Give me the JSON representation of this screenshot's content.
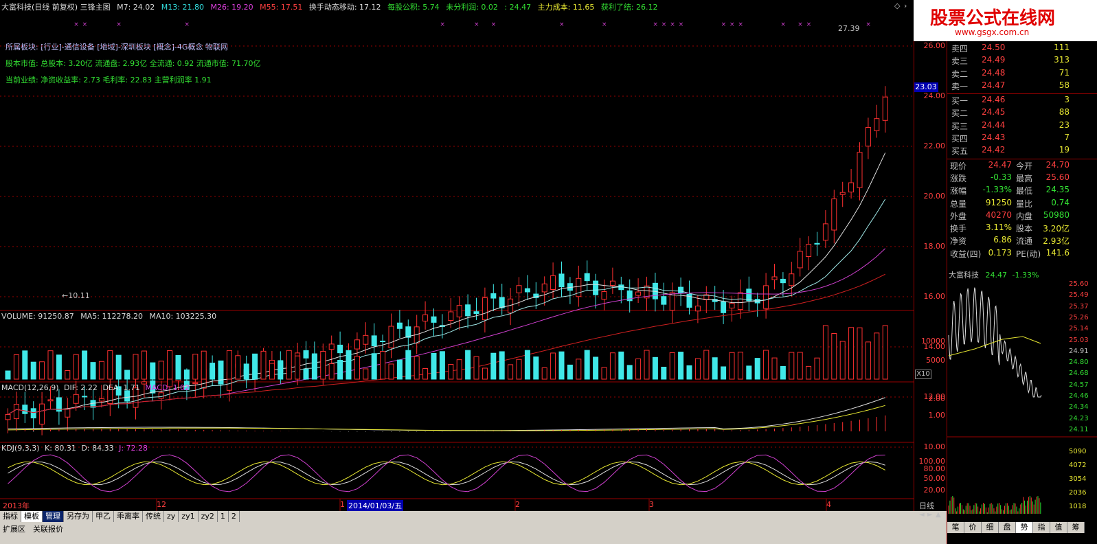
{
  "header": {
    "stock": "大富科技(日线 前复权) 三锋主图",
    "ma7": "M7: 24.02",
    "ma13": "M13: 21.80",
    "ma26": "M26: 19.20",
    "ma55": "M55: 17.51",
    "huanshou": "换手动态移动: 17.12",
    "gongji": "每股公积: 5.74",
    "weifen": "未分利润: 0.02",
    "price": ": 24.47",
    "chengben": "主力成本: 11.65",
    "huoli": "获利了结: 26.12"
  },
  "info_lines": {
    "sector": "所属板块: [行业]-通信设备 [地域]-深圳板块 [概念]-4G概念 物联网",
    "capital": "股本市值: 总股本: 3.20亿 流通盘: 2.93亿 全流通: 0.92 流通市值: 71.70亿",
    "performance": "当前业绩: 净资收益率: 2.73 毛利率: 22.83 主营利润率 1.91"
  },
  "price_axis": [
    "26.00",
    "24.00",
    "22.00",
    "20.00",
    "18.00",
    "16.00",
    "14.00",
    "12.00",
    "10.00"
  ],
  "current_price_tag": "23.03",
  "high_mark": "27.39",
  "low_mark": "←10.11",
  "volume": {
    "title": "VOLUME: 91250.87",
    "ma5": "MA5: 112278.20",
    "ma10": "MA10: 103225.30",
    "axis": [
      "10000",
      "5000"
    ],
    "unit": "X10"
  },
  "macd": {
    "title": "MACD(12,26,9)",
    "dif": "DIF: 2.22",
    "dea": "DEA: 1.71",
    "macd": "MACD: 1.02",
    "axis": [
      "2.00",
      "1.00"
    ]
  },
  "kdj": {
    "title": "KDJ(9,3,3)",
    "k": "K: 80.31",
    "d": "D: 84.33",
    "j": "J: 72.28",
    "axis": [
      "100.00",
      "80.00",
      "50.00",
      "20.00"
    ]
  },
  "date_axis": {
    "year": "2013年",
    "m12": "12",
    "m1": "1",
    "cursor_date": "2014/01/03/五",
    "m2": "2",
    "m3": "3",
    "m4": "4"
  },
  "tabs": [
    "指标",
    "模板",
    "管理",
    "另存为",
    "甲乙",
    "乖离率",
    "传统",
    "zy",
    "zy1",
    "zy2",
    "1",
    "2"
  ],
  "status": [
    "扩展区",
    "关联报价"
  ],
  "logo": {
    "title": "股票公式在线网",
    "url": "www.gsgx.com.cn"
  },
  "quote": {
    "asks": [
      {
        "name": "卖四",
        "price": "24.50",
        "vol": "111"
      },
      {
        "name": "卖三",
        "price": "24.49",
        "vol": "313"
      },
      {
        "name": "卖二",
        "price": "24.48",
        "vol": "71"
      },
      {
        "name": "卖一",
        "price": "24.47",
        "vol": "58"
      }
    ],
    "bids": [
      {
        "name": "买一",
        "price": "24.46",
        "vol": "3"
      },
      {
        "name": "买二",
        "price": "24.45",
        "vol": "88"
      },
      {
        "name": "买三",
        "price": "24.44",
        "vol": "23"
      },
      {
        "name": "买四",
        "price": "24.43",
        "vol": "7"
      },
      {
        "name": "买五",
        "price": "24.42",
        "vol": "19"
      }
    ]
  },
  "stats": [
    {
      "l1": "现价",
      "v1": "24.47",
      "c1": "#ff4040",
      "l2": "今开",
      "v2": "24.70",
      "c2": "#ff4040"
    },
    {
      "l1": "涨跌",
      "v1": "-0.33",
      "c1": "#33e033",
      "l2": "最高",
      "v2": "25.60",
      "c2": "#ff4040"
    },
    {
      "l1": "涨幅",
      "v1": "-1.33%",
      "c1": "#33e033",
      "l2": "最低",
      "v2": "24.35",
      "c2": "#33e033"
    },
    {
      "l1": "总量",
      "v1": "91250",
      "c1": "#e6e632",
      "l2": "量比",
      "v2": "0.74",
      "c2": "#33e033"
    },
    {
      "l1": "外盘",
      "v1": "40270",
      "c1": "#ff4040",
      "l2": "内盘",
      "v2": "50980",
      "c2": "#33e033"
    },
    {
      "l1": "换手",
      "v1": "3.11%",
      "c1": "#e6e632",
      "l2": "股本",
      "v2": "3.20亿",
      "c2": "#e6e632"
    },
    {
      "l1": "净资",
      "v1": "6.86",
      "c1": "#e6e632",
      "l2": "流通",
      "v2": "2.93亿",
      "c2": "#e6e632"
    },
    {
      "l1": "收益(四)",
      "v1": "0.173",
      "c1": "#e6e632",
      "l2": "PE(动)",
      "v2": "141.6",
      "c2": "#e6e632"
    }
  ],
  "mini": {
    "name": "大富科技",
    "price": "24.47",
    "pct": "-1.33%",
    "axis": [
      "25.60",
      "25.49",
      "25.37",
      "25.26",
      "25.14",
      "25.03",
      "24.91",
      "24.80",
      "24.68",
      "24.57",
      "24.46",
      "24.34",
      "24.23",
      "24.11"
    ],
    "vol_axis": [
      "5090",
      "4072",
      "3054",
      "2036",
      "1018"
    ]
  },
  "right_tabs": [
    "笔",
    "价",
    "细",
    "盘",
    "势",
    "指",
    "值",
    "筹"
  ],
  "period": "日线"
}
